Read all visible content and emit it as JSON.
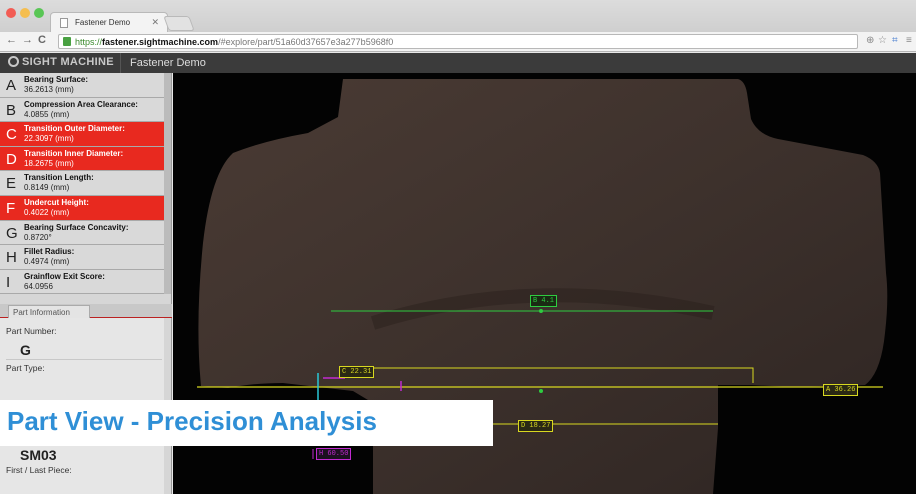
{
  "browser": {
    "tab_title": "Fastener Demo",
    "url_scheme": "https://",
    "url_host": "fastener.sightmachine.com",
    "url_path": "/#explore/part/51a60d37657e3a277b5968f0"
  },
  "app": {
    "logo": "SIGHT MACHINE",
    "title": "Fastener Demo"
  },
  "measurements": [
    {
      "letter": "A",
      "name": "Bearing Surface:",
      "value": "36.2613 (mm)",
      "highlight": false
    },
    {
      "letter": "B",
      "name": "Compression Area Clearance:",
      "value": "4.0855 (mm)",
      "highlight": false
    },
    {
      "letter": "C",
      "name": "Transition Outer Diameter:",
      "value": "22.3097 (mm)",
      "highlight": true
    },
    {
      "letter": "D",
      "name": "Transition Inner Diameter:",
      "value": "18.2675 (mm)",
      "highlight": true
    },
    {
      "letter": "E",
      "name": "Transition Length:",
      "value": "0.8149 (mm)",
      "highlight": false
    },
    {
      "letter": "F",
      "name": "Undercut Height:",
      "value": "0.4022 (mm)",
      "highlight": true
    },
    {
      "letter": "G",
      "name": "Bearing Surface Concavity:",
      "value": "0.8720°",
      "highlight": false
    },
    {
      "letter": "H",
      "name": "Fillet Radius:",
      "value": "0.4974 (mm)",
      "highlight": false
    },
    {
      "letter": "I",
      "name": "Grainflow Exit Score:",
      "value": "64.0956",
      "highlight": false
    }
  ],
  "part_info": {
    "tab_label": "Part Information",
    "part_number_label": "Part Number:",
    "part_number": "G",
    "part_type_label": "Part Type:",
    "machine": "SM03",
    "first_last_label": "First / Last Piece:"
  },
  "annotations": {
    "b": "B 4.1",
    "c": "C 22.31",
    "a": "A 36.26",
    "d": "D 18.27",
    "h": "H 60.50"
  },
  "banner": {
    "text": "Part View - Precision Analysis"
  },
  "colors": {
    "highlight_red": "#e8291f",
    "annotation_green": "#2ecc40",
    "annotation_yellow": "#d8d820",
    "banner_blue": "#2f8fd6"
  }
}
